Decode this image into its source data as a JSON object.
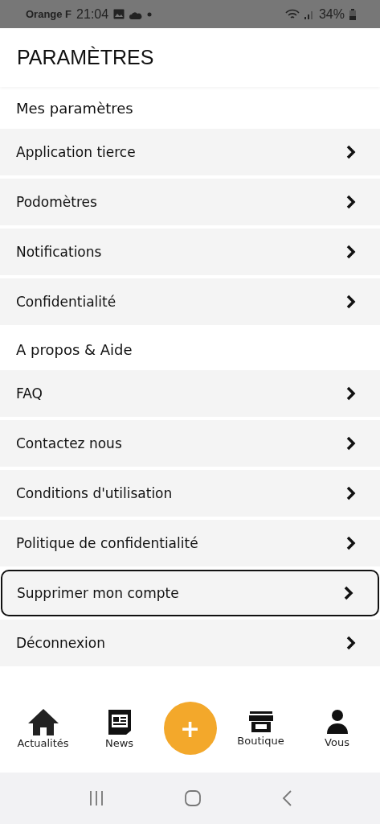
{
  "status_bar": {
    "carrier": "Orange F",
    "time": "21:04",
    "battery": "34%"
  },
  "header": {
    "title": "PARAMÈTRES"
  },
  "sections": [
    {
      "title": "Mes paramètres",
      "items": [
        {
          "label": "Application tierce",
          "selected": false
        },
        {
          "label": "Podomètres",
          "selected": false
        },
        {
          "label": "Notifications",
          "selected": false
        },
        {
          "label": "Confidentialité",
          "selected": false
        }
      ]
    },
    {
      "title": "A propos & Aide",
      "items": [
        {
          "label": "FAQ",
          "selected": false
        },
        {
          "label": "Contactez nous",
          "selected": false
        },
        {
          "label": "Conditions d'utilisation",
          "selected": false
        },
        {
          "label": "Politique de confidentialité",
          "selected": false
        },
        {
          "label": "Supprimer mon compte",
          "selected": true
        },
        {
          "label": "Déconnexion",
          "selected": false
        }
      ]
    }
  ],
  "tab_bar": [
    {
      "kind": "home",
      "label": "Actualités"
    },
    {
      "kind": "news",
      "label": "News"
    },
    {
      "kind": "add",
      "label": "+"
    },
    {
      "kind": "shop",
      "label": "Boutique"
    },
    {
      "kind": "user",
      "label": "Vous"
    }
  ]
}
